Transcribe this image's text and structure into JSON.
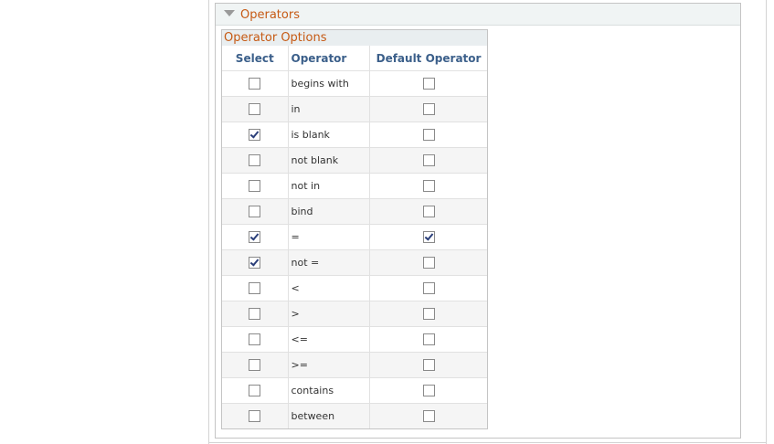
{
  "section": {
    "title": "Operators"
  },
  "grid": {
    "title": "Operator Options",
    "columns": {
      "select": "Select",
      "operator": "Operator",
      "default_operator": "Default Operator"
    },
    "rows": [
      {
        "operator": "begins with",
        "select": false,
        "default": false
      },
      {
        "operator": "in",
        "select": false,
        "default": false
      },
      {
        "operator": "is blank",
        "select": true,
        "default": false
      },
      {
        "operator": "not blank",
        "select": false,
        "default": false
      },
      {
        "operator": "not in",
        "select": false,
        "default": false
      },
      {
        "operator": "bind",
        "select": false,
        "default": false
      },
      {
        "operator": "=",
        "select": true,
        "default": true
      },
      {
        "operator": "not =",
        "select": true,
        "default": false
      },
      {
        "operator": "<",
        "select": false,
        "default": false
      },
      {
        "operator": ">",
        "select": false,
        "default": false
      },
      {
        "operator": "<=",
        "select": false,
        "default": false
      },
      {
        "operator": ">=",
        "select": false,
        "default": false
      },
      {
        "operator": "contains",
        "select": false,
        "default": false
      },
      {
        "operator": "between",
        "select": false,
        "default": false
      }
    ]
  },
  "colors": {
    "title_orange": "#c65a14",
    "header_blue": "#3b5f8a",
    "header_background": "#f0f4f4"
  }
}
